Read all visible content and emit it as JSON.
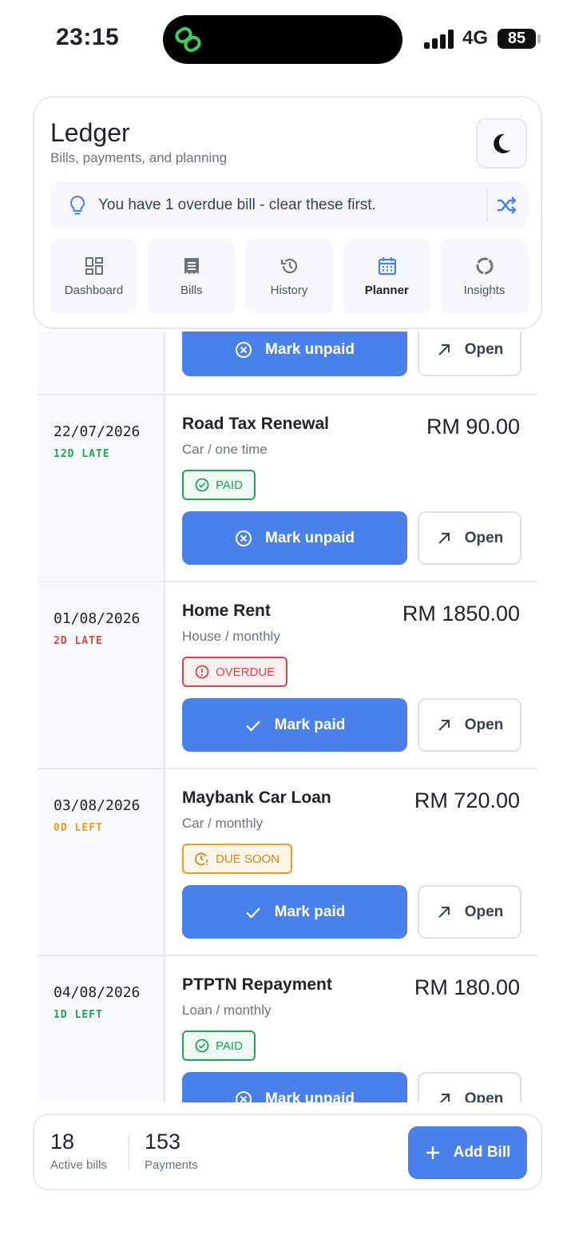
{
  "status_bar": {
    "time": "23:15",
    "network": "4G",
    "battery": "85"
  },
  "header": {
    "title": "Ledger",
    "subtitle": "Bills, payments, and planning",
    "alert_text": "You have 1 overdue bill - clear these first."
  },
  "nav": [
    {
      "label": "Dashboard",
      "icon": "dashboard-icon",
      "active": false
    },
    {
      "label": "Bills",
      "icon": "receipt-icon",
      "active": false
    },
    {
      "label": "History",
      "icon": "history-icon",
      "active": false
    },
    {
      "label": "Planner",
      "icon": "calendar-icon",
      "active": true
    },
    {
      "label": "Insights",
      "icon": "donut-chart-icon",
      "active": false
    }
  ],
  "partial_top_row": {
    "primary_label": "Mark unpaid",
    "open_label": "Open"
  },
  "bills": [
    {
      "date": "22/07/2026",
      "days": "12D LATE",
      "days_color": "#22a55a",
      "name": "Road Tax Renewal",
      "meta": "Car / one time",
      "amount": "RM 90.00",
      "status": "PAID",
      "status_type": "paid",
      "primary_label": "Mark unpaid",
      "primary_icon": "circle-x-icon",
      "open_label": "Open"
    },
    {
      "date": "01/08/2026",
      "days": "2D LATE",
      "days_color": "#dc4646",
      "name": "Home Rent",
      "meta": "House / monthly",
      "amount": "RM 1850.00",
      "status": "OVERDUE",
      "status_type": "overdue",
      "primary_label": "Mark paid",
      "primary_icon": "check-icon",
      "open_label": "Open"
    },
    {
      "date": "03/08/2026",
      "days": "0D LEFT",
      "days_color": "#ef9a1f",
      "name": "Maybank Car Loan",
      "meta": "Car / monthly",
      "amount": "RM 720.00",
      "status": "DUE SOON",
      "status_type": "soon",
      "primary_label": "Mark paid",
      "primary_icon": "check-icon",
      "open_label": "Open"
    },
    {
      "date": "04/08/2026",
      "days": "1D LEFT",
      "days_color": "#22a55a",
      "name": "PTPTN Repayment",
      "meta": "Loan / monthly",
      "amount": "RM 180.00",
      "status": "PAID",
      "status_type": "paid",
      "primary_label": "Mark unpaid",
      "primary_icon": "circle-x-icon",
      "open_label": "Open"
    }
  ],
  "footer": {
    "active_bills": "18",
    "active_bills_label": "Active bills",
    "payments": "153",
    "payments_label": "Payments",
    "add_label": "Add Bill"
  },
  "colors": {
    "accent": "#4a80ea",
    "paid": "#22a55a",
    "overdue": "#dc4646",
    "soon": "#ef9a1f",
    "brand_green": "#3ecf5a"
  }
}
